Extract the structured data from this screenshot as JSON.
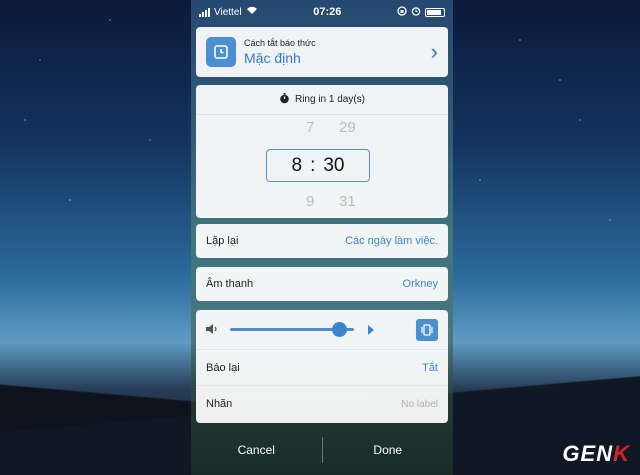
{
  "status_bar": {
    "carrier": "Viettel",
    "time": "07:26"
  },
  "alarm_type": {
    "subtitle": "Cách tắt báo thức",
    "value": "Mặc định"
  },
  "ring_info": "Ring in 1 day(s)",
  "time_picker": {
    "prev_hour": "7",
    "prev_minute": "29",
    "hour": "8",
    "separator": ":",
    "minute": "30",
    "next_hour": "9",
    "next_minute": "31"
  },
  "repeat": {
    "label": "Lặp lại",
    "value": "Các ngày làm việc."
  },
  "sound": {
    "label": "Âm thanh",
    "value": "Orkney"
  },
  "volume": {
    "level": 0.88
  },
  "snooze": {
    "label": "Báo lại",
    "value": "Tắt"
  },
  "name_field": {
    "label": "Nhãn",
    "placeholder": "No label"
  },
  "actions": {
    "cancel": "Cancel",
    "done": "Done"
  },
  "watermark": {
    "logo": "GENK"
  },
  "colors": {
    "accent": "#3c85c9",
    "badge": "#4a8fd0"
  }
}
